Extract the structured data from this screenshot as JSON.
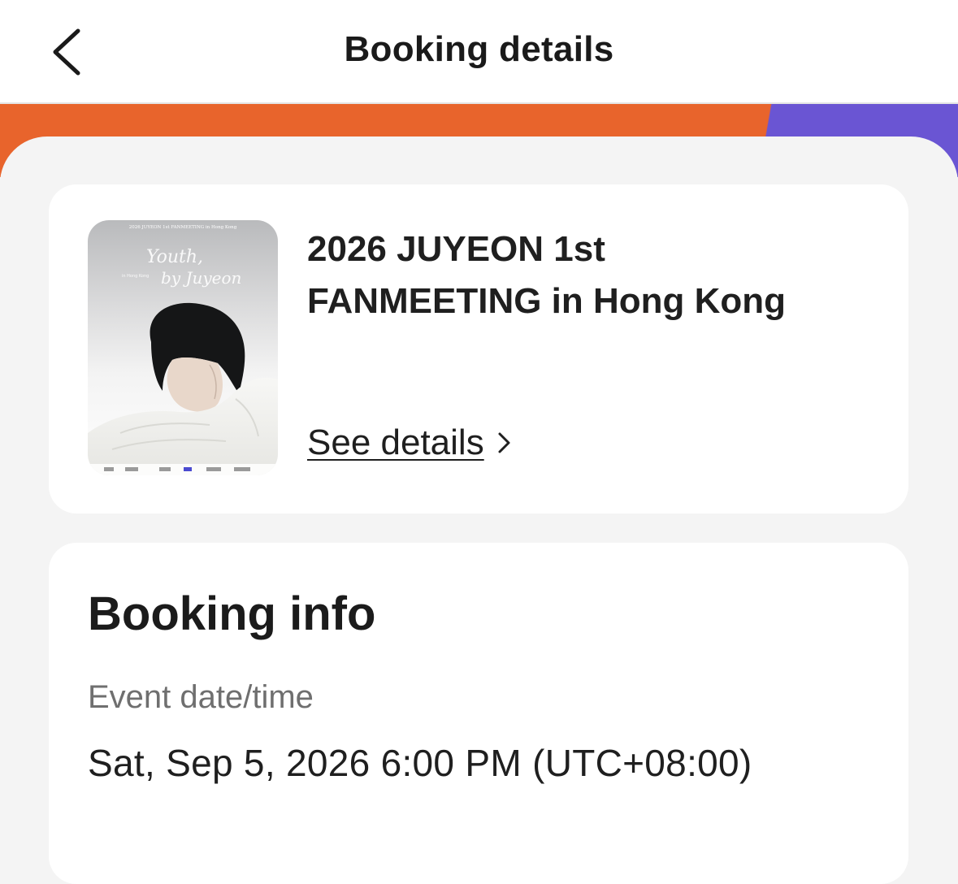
{
  "header": {
    "title": "Booking details",
    "back_icon": "chevron-left-icon"
  },
  "banner": {
    "colors": [
      "#e8642c",
      "#6a55d3"
    ]
  },
  "event": {
    "poster": {
      "top_caption": "2026 JUYEON 1st FANMEETING in Hong Kong",
      "script_line1": "Youth,",
      "script_line2": "by Juyeon",
      "small_tag": "in Hong Kong"
    },
    "title_line1": "2026 JUYEON 1st",
    "title_line2": "FANMEETING in Hong Kong",
    "see_details_label": "See details",
    "see_details_icon": "chevron-right-icon"
  },
  "booking_info": {
    "title": "Booking info",
    "event_datetime_label": "Event date/time",
    "event_datetime_value": "Sat, Sep 5, 2026 6:00 PM (UTC+08:00)"
  },
  "colors": {
    "accent_orange": "#e8642c",
    "accent_purple": "#6a55d3",
    "background": "#f4f4f4",
    "card": "#ffffff"
  }
}
